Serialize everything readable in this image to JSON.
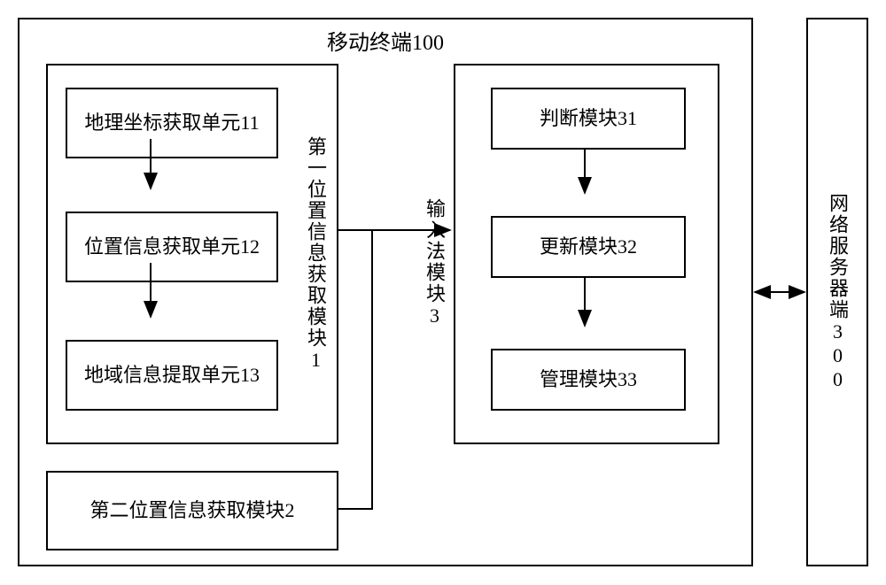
{
  "terminal": {
    "title": "移动终端100",
    "module1": {
      "label": "第一位置信息获取模块1",
      "unit11": "地理坐标获取单元11",
      "unit12": "位置信息获取单元12",
      "unit13": "地域信息提取单元13"
    },
    "module2": {
      "label": "第二位置信息获取模块2"
    },
    "module3": {
      "label": "输入法模块3",
      "block31": "判断模块31",
      "block32": "更新模块32",
      "block33": "管理模块33"
    }
  },
  "server": {
    "label": "网络服务器端300"
  }
}
